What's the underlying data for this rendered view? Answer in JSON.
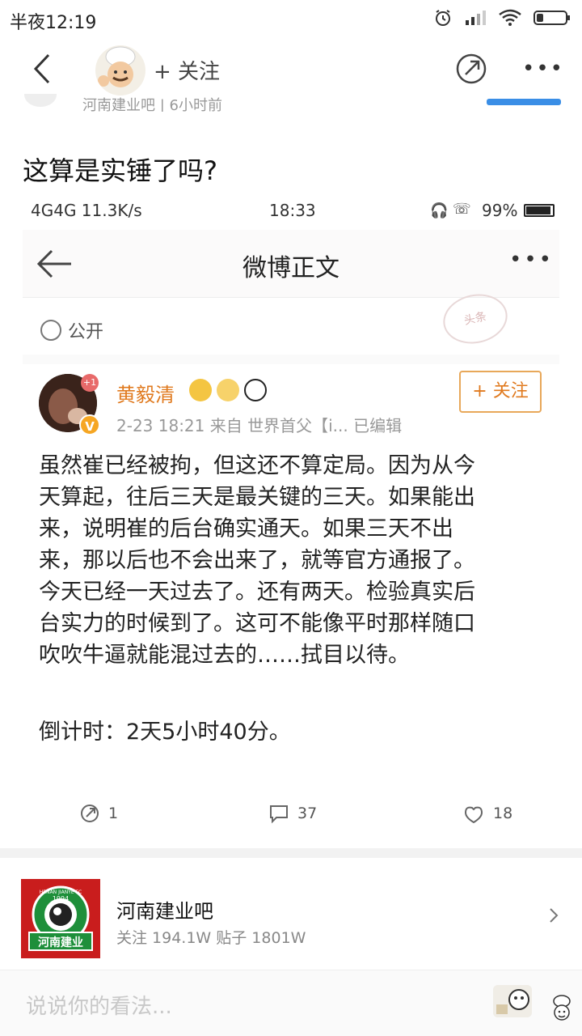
{
  "status_bar": {
    "time": "半夜12:19",
    "icons": [
      "alarm-icon",
      "signal-icon",
      "wifi-icon",
      "battery-icon"
    ]
  },
  "nav": {
    "follow_label": "+ 关注",
    "icons": [
      "back-icon",
      "chef-avatar",
      "share-icon",
      "more-icon"
    ]
  },
  "peek_row": {
    "forum_name": "河南建业吧",
    "time_ago": "6小时前"
  },
  "post": {
    "title": "这算是实锤了吗?"
  },
  "embedded": {
    "status": {
      "network": "4G4G 11.3K/s",
      "time": "18:33",
      "battery": "99%"
    },
    "nav_title": "微博正文",
    "visibility": "公开",
    "stamp_text": "头条",
    "user": {
      "name": "黄毅清",
      "avatar_badge": "+1",
      "verified_mark": "V",
      "meta": "2-23 18:21  来自 世界首父【i...  已编辑",
      "follow_label": "+ 关注"
    },
    "body_lines": [
      "虽然崔已经被拘，但这还不算定局。因为从今",
      "天算起，往后三天是最关键的三天。如果能出",
      "来，说明崔的后台确实通天。如果三天不出",
      "来，那以后也不会出来了，就等官方通报了。",
      "今天已经一天过去了。还有两天。检验真实后",
      "台实力的时候到了。这可不能像平时那样随口",
      "吹吹牛逼就能混过去的……拭目以待。"
    ],
    "countdown": "倒计时：2天5小时40分。",
    "actions": {
      "repost_count": "1",
      "comment_count": "37",
      "like_count": "18"
    }
  },
  "forum_card": {
    "name": "河南建业吧",
    "stats": "关注 194.1W   贴子 1801W",
    "logo_year": "1994",
    "logo_top": "HENAN JIANYE FC",
    "logo_bottom": "河南建业"
  },
  "comment_bar": {
    "placeholder": "说说你的看法..."
  },
  "colors": {
    "accent_orange": "#e07a1f",
    "follow_border": "#e8a85a",
    "link_blue": "#3a8ee6",
    "logo_red": "#c91d1d"
  }
}
